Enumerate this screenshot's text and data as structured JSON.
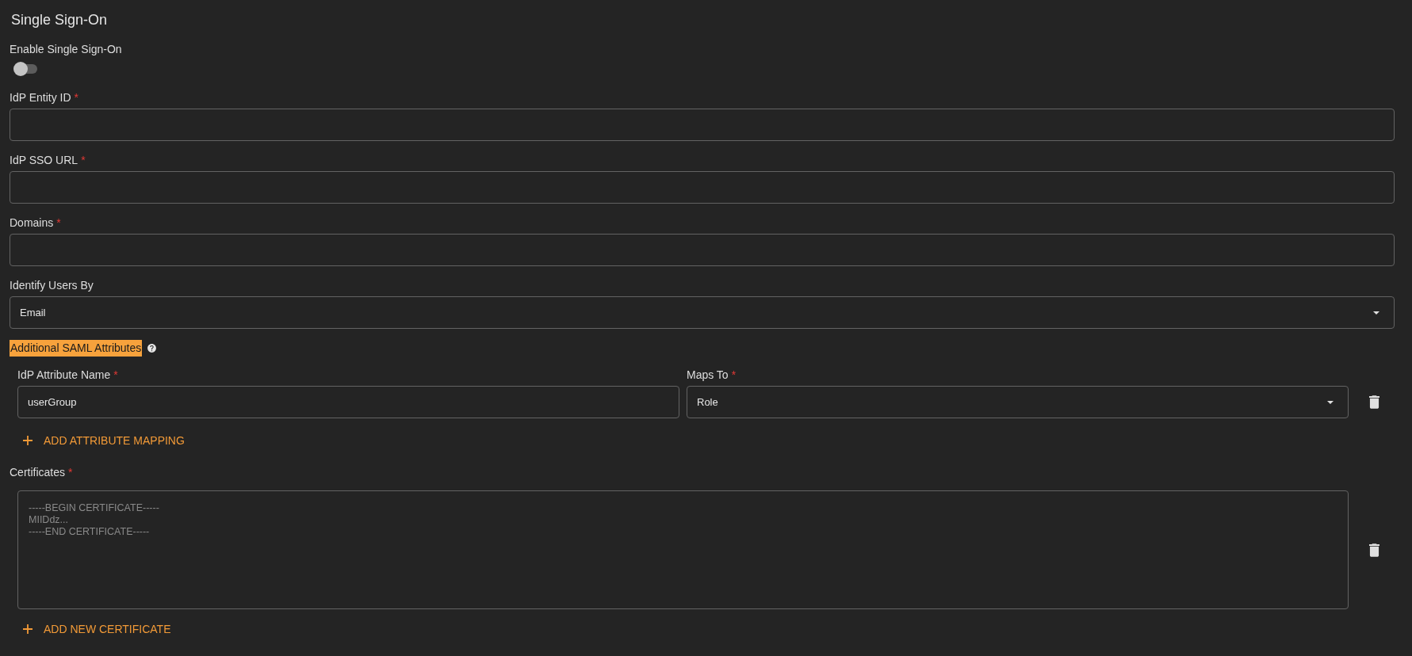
{
  "page": {
    "title": "Single Sign-On"
  },
  "sso_toggle": {
    "label": "Enable Single Sign-On",
    "on": false
  },
  "fields": [
    {
      "kind": "text",
      "label": "IdP Entity ID",
      "required_mark": "*"
    },
    {
      "kind": "text",
      "label": "IdP SSO URL",
      "required_mark": "*"
    },
    {
      "kind": "text",
      "label": "Domains",
      "required_mark": "*"
    },
    {
      "kind": "select",
      "label": "Identify Users By",
      "value": "Email"
    }
  ],
  "saml_attributes": {
    "title": "Additional SAML Attributes",
    "highlighted": true,
    "mappings": [
      {
        "name": {
          "label": "IdP Attribute Name",
          "required_mark": "*",
          "value": "userGroup"
        },
        "maps_to": {
          "label": "Maps To",
          "required_mark": "*",
          "value": "Role"
        }
      }
    ],
    "add_button": "ADD ATTRIBUTE MAPPING"
  },
  "certificates": {
    "label": "Certificates",
    "required_mark": "*",
    "items": [
      {
        "placeholder": "-----BEGIN CERTIFICATE-----\nMIIDdz...\n-----END CERTIFICATE-----"
      }
    ],
    "add_button": "ADD NEW CERTIFICATE"
  }
}
